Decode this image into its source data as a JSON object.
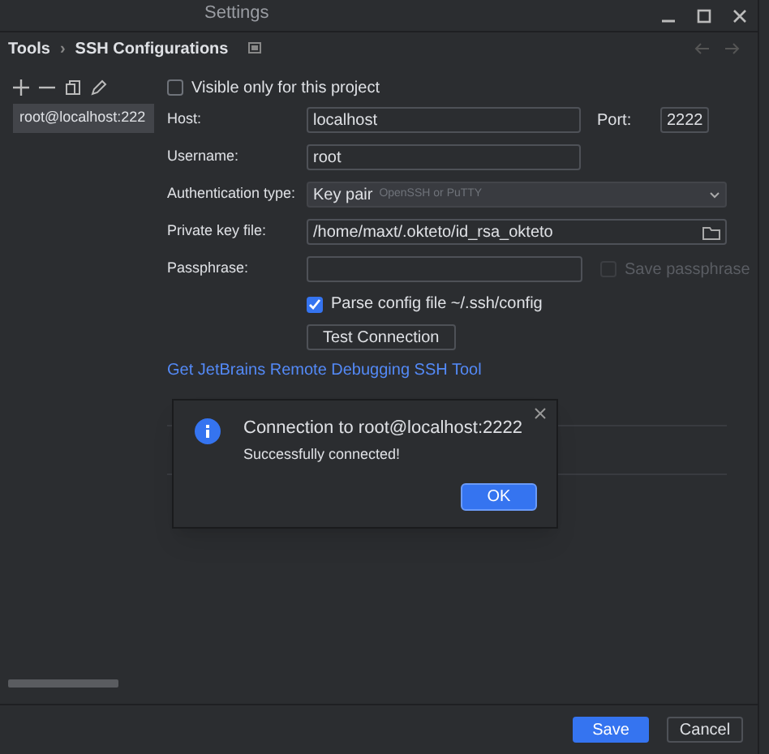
{
  "window": {
    "title": "Settings"
  },
  "breadcrumb": {
    "parent": "Tools",
    "separator": "›",
    "current": "SSH Configurations"
  },
  "sidebar": {
    "items": [
      {
        "label": "root@localhost:222",
        "selected": true
      }
    ]
  },
  "form": {
    "visible_only": {
      "label": "Visible only for this project",
      "checked": false
    },
    "host": {
      "label": "Host:",
      "value": "localhost"
    },
    "port": {
      "label": "Port:",
      "value": "2222"
    },
    "username": {
      "label": "Username:",
      "value": "root"
    },
    "auth_type": {
      "label": "Authentication type:",
      "value": "Key pair",
      "hint": "OpenSSH or PuTTY"
    },
    "private_key": {
      "label": "Private key file:",
      "value": "/home/maxt/.okteto/id_rsa_okteto"
    },
    "passphrase": {
      "label": "Passphrase:"
    },
    "save_passphrase": {
      "label": "Save passphrase",
      "checked": false,
      "disabled": true
    },
    "parse_config": {
      "label": "Parse config file ~/.ssh/config",
      "checked": true
    },
    "test_button": "Test Connection",
    "link": "Get JetBrains Remote Debugging SSH Tool"
  },
  "dialog": {
    "title": "Connection to root@localhost:2222",
    "message": "Successfully connected!",
    "button": "OK"
  },
  "footer": {
    "buttons": [
      {
        "label": "Save",
        "kind": "primary"
      },
      {
        "label": "Cancel",
        "kind": "secondary"
      }
    ]
  }
}
